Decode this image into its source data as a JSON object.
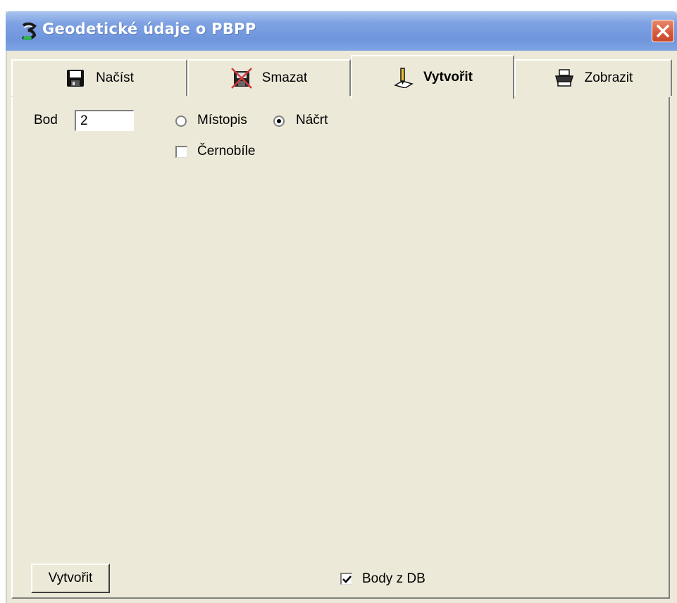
{
  "window": {
    "title": "Geodetické údaje o PBPP"
  },
  "tabs": [
    {
      "label": "Načíst",
      "icon": "floppy-disk-icon",
      "active": false
    },
    {
      "label": "Smazat",
      "icon": "floppy-delete-icon",
      "active": false
    },
    {
      "label": "Vytvořit",
      "icon": "pen-paper-icon",
      "active": true
    },
    {
      "label": "Zobrazit",
      "icon": "printer-icon",
      "active": false
    }
  ],
  "form": {
    "bod_label": "Bod",
    "bod_value": "2",
    "radio_mistopis": "Místopis",
    "radio_nacrt": "Náčrt",
    "selected_radio": "Náčrt",
    "checkbox_cernobile": "Černobíle",
    "cernobile_checked": false,
    "create_button": "Vytvořit",
    "checkbox_body_db": "Body z DB",
    "body_db_checked": true
  },
  "colors": {
    "titlebar": "#6f95dc",
    "background": "#ece9d8",
    "close": "#d5593a"
  }
}
